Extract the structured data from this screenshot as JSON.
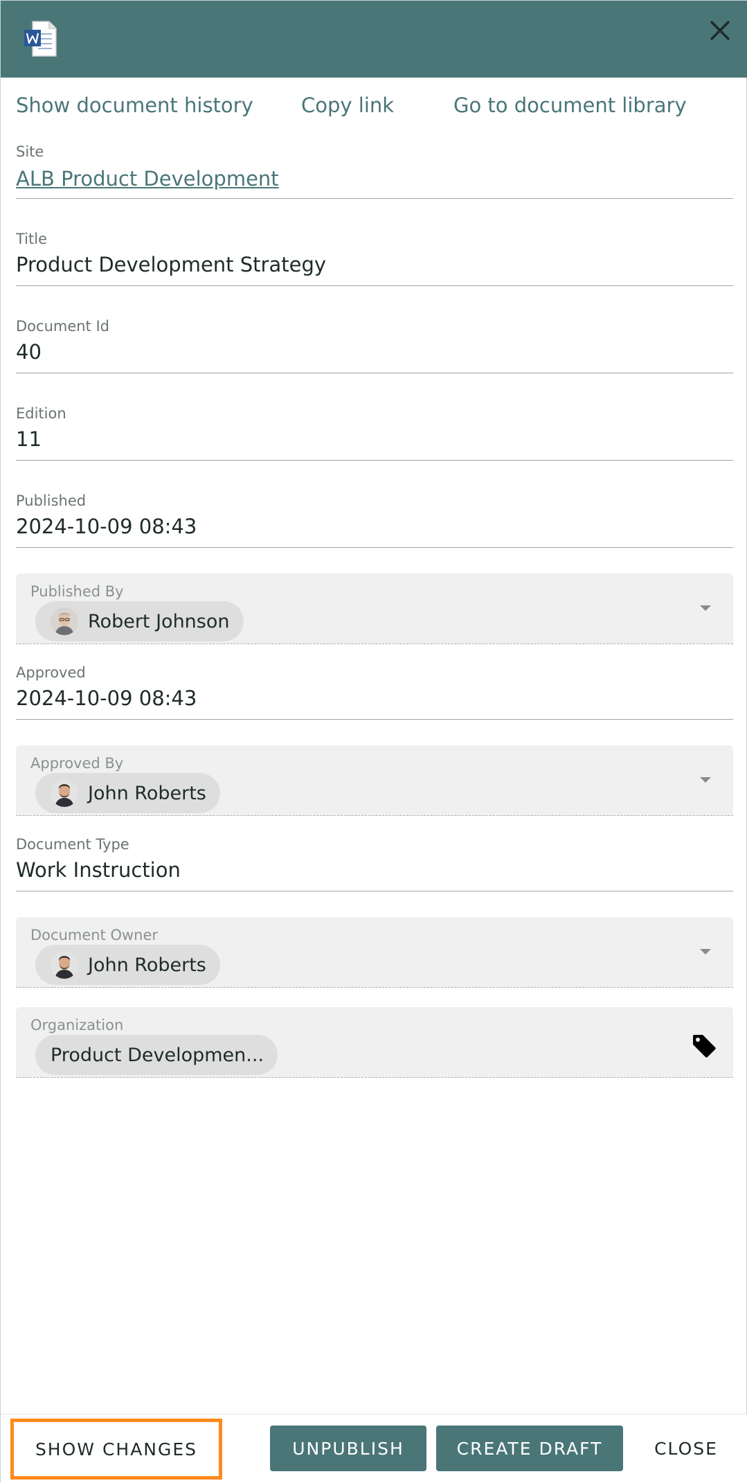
{
  "header": {
    "doc_icon": "word-document-icon",
    "close_icon": "close-icon",
    "background": "#4a7678"
  },
  "links": {
    "history": "Show document history",
    "copy": "Copy link",
    "library": "Go to document library"
  },
  "fields": {
    "site": {
      "label": "Site",
      "value": "ALB Product Development"
    },
    "title": {
      "label": "Title",
      "value": "Product Development Strategy"
    },
    "document_id": {
      "label": "Document Id",
      "value": "40"
    },
    "edition": {
      "label": "Edition",
      "value": "11"
    },
    "published": {
      "label": "Published",
      "value": "2024-10-09 08:43"
    },
    "published_by": {
      "label": "Published By",
      "value": "Robert Johnson"
    },
    "approved": {
      "label": "Approved",
      "value": "2024-10-09 08:43"
    },
    "approved_by": {
      "label": "Approved By",
      "value": "John Roberts"
    },
    "document_type": {
      "label": "Document Type",
      "value": "Work Instruction"
    },
    "document_owner": {
      "label": "Document Owner",
      "value": "John Roberts"
    },
    "organization": {
      "label": "Organization",
      "value": "Product Developmen..."
    }
  },
  "footer": {
    "show_changes": "SHOW CHANGES",
    "unpublish": "UNPUBLISH",
    "create_draft": "CREATE DRAFT",
    "close": "CLOSE"
  },
  "colors": {
    "accent": "#4a7678",
    "highlight": "#ff8a1c"
  }
}
